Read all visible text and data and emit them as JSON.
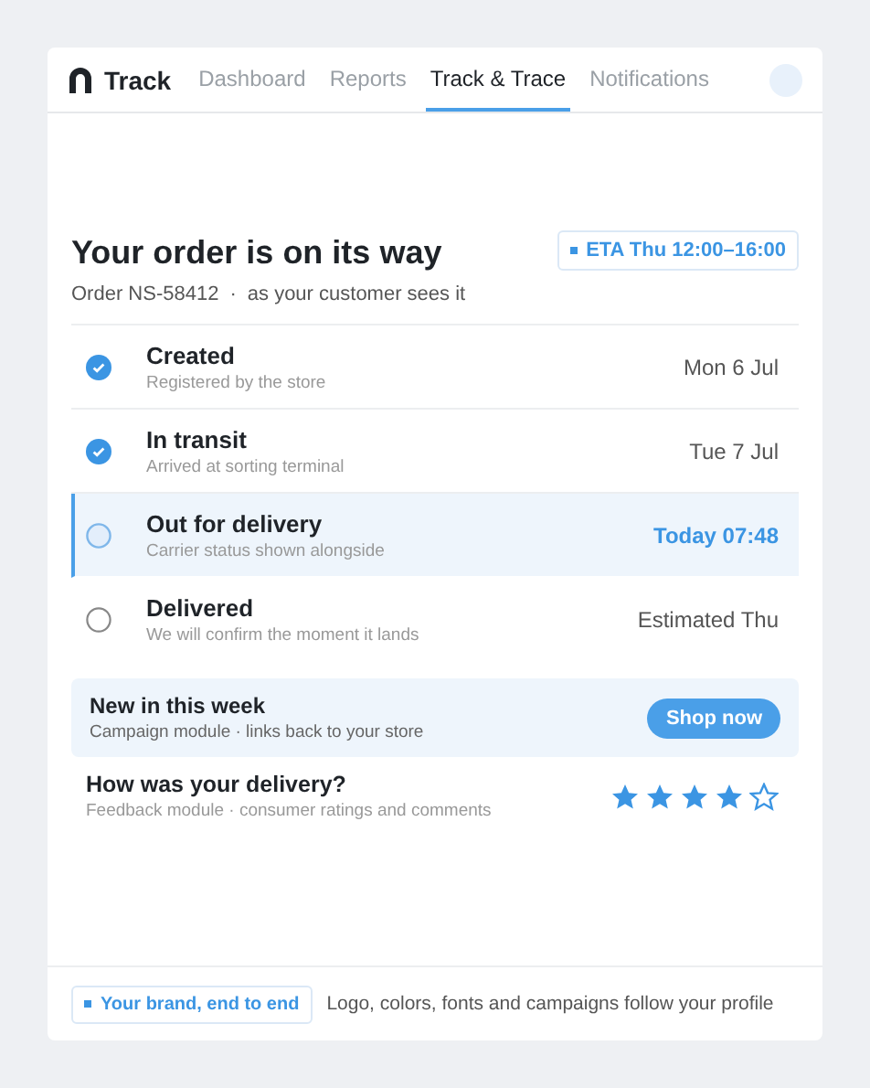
{
  "nav": {
    "brand": "Track",
    "tabs": [
      {
        "label": "Dashboard",
        "selected": false
      },
      {
        "label": "Reports",
        "selected": false
      },
      {
        "label": "Track & Trace",
        "selected": true
      },
      {
        "label": "Notifications",
        "selected": false
      }
    ]
  },
  "order": {
    "title": "Your order is on its way",
    "number": "Order NS-58412",
    "separator": "·",
    "note": "as your customer sees it",
    "eta": "ETA Thu 12:00–16:00"
  },
  "steps": [
    {
      "title": "Created",
      "subtitle": "Registered by the store",
      "time": "Mon 6 Jul",
      "kind": "done"
    },
    {
      "title": "In transit",
      "subtitle": "Arrived at sorting terminal",
      "time": "Tue 7 Jul",
      "kind": "done"
    },
    {
      "title": "Out for delivery",
      "subtitle": "Carrier status shown alongside",
      "time": "Today 07:48",
      "kind": "current"
    },
    {
      "title": "Delivered",
      "subtitle": "We will confirm the moment it lands",
      "time": "Estimated Thu",
      "kind": "pending"
    }
  ],
  "promo": {
    "title": "New in this week",
    "subtitle": "Campaign module · links back to your store",
    "button": "Shop now"
  },
  "feedback": {
    "title": "How was your delivery?",
    "subtitle": "Feedback module · consumer ratings and comments",
    "stars": 4
  },
  "footer": {
    "badge": "Your brand, end to end",
    "text": "Logo, colors, fonts and campaigns follow your profile"
  }
}
